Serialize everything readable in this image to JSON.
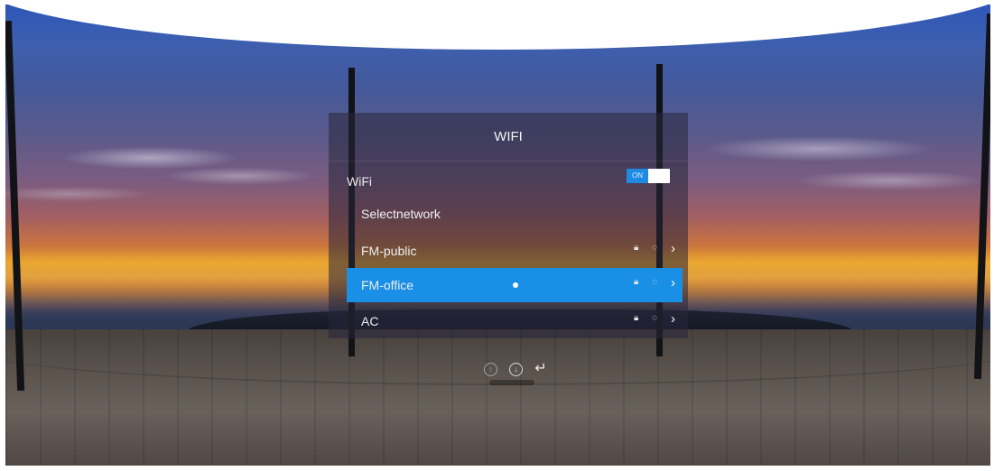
{
  "panel": {
    "title": "WIFI",
    "wifi_label": "WiFi",
    "toggle_state": "ON",
    "select_label": "Selectnetwork"
  },
  "networks": [
    {
      "name": "FM-public",
      "selected": false,
      "icons": [
        "lock-icon",
        "signal-icon",
        "chevron-right-icon"
      ]
    },
    {
      "name": "FM-office",
      "selected": true,
      "icons": [
        "lock-icon",
        "signal-icon",
        "chevron-right-icon"
      ]
    },
    {
      "name": "AC",
      "selected": false,
      "icons": [
        "lock-icon",
        "signal-icon",
        "chevron-right-icon"
      ]
    }
  ],
  "bottom_controls": [
    "up-icon",
    "download-icon",
    "back-icon"
  ],
  "colors": {
    "accent": "#1a8fe6",
    "toggle_on": "#1e8ae3"
  }
}
